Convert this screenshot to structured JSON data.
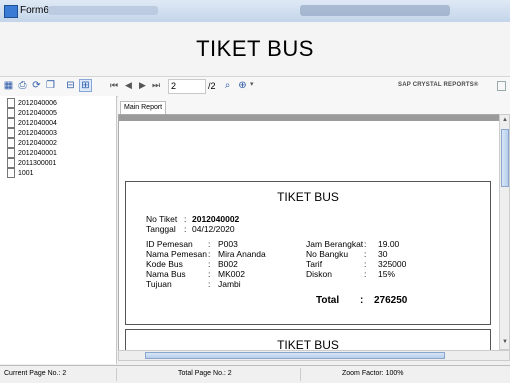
{
  "window": {
    "title": "Form6"
  },
  "header": {
    "title": "TIKET BUS"
  },
  "toolbar": {
    "icons": [
      "export-icon",
      "print-icon",
      "refresh-icon",
      "copy-icon",
      "group-tree-icon",
      "toggle-panel-icon"
    ],
    "nav_first": "⏮",
    "nav_prev": "◀",
    "nav_next": "▶",
    "nav_last": "⏭",
    "current_page": "2",
    "total_pages": "/2",
    "brand": "SAP CRYSTAL REPORTS®"
  },
  "tree": {
    "items": [
      "2012040006",
      "2012040005",
      "2012040004",
      "2012040003",
      "2012040002",
      "2012040001",
      "2011300001",
      "1001"
    ]
  },
  "tabs": {
    "main_report": "Main Report"
  },
  "report": {
    "title": "TIKET BUS",
    "no_tiket_label": "No Tiket",
    "no_tiket_value": "2012040002",
    "tanggal_label": "Tanggal",
    "tanggal_value": "04/12/2020",
    "left_fields": [
      {
        "label": "ID Pemesan",
        "value": "P003"
      },
      {
        "label": "Nama Pemesan",
        "value": "Mira Ananda"
      },
      {
        "label": "Kode Bus",
        "value": "B002"
      },
      {
        "label": "Nama Bus",
        "value": "MK002"
      },
      {
        "label": "Tujuan",
        "value": "Jambi"
      }
    ],
    "right_fields": [
      {
        "label": "Jam Berangkat",
        "value": "19.00"
      },
      {
        "label": "No Bangku",
        "value": "30"
      },
      {
        "label": "Tarif",
        "value": "325000"
      },
      {
        "label": "Diskon",
        "value": "15%"
      }
    ],
    "total_label": "Total",
    "total_value": "276250",
    "next_title": "TIKET BUS"
  },
  "status": {
    "current_page": "Current Page No.: 2",
    "total_page": "Total Page No.: 2",
    "zoom": "Zoom Factor: 100%"
  }
}
